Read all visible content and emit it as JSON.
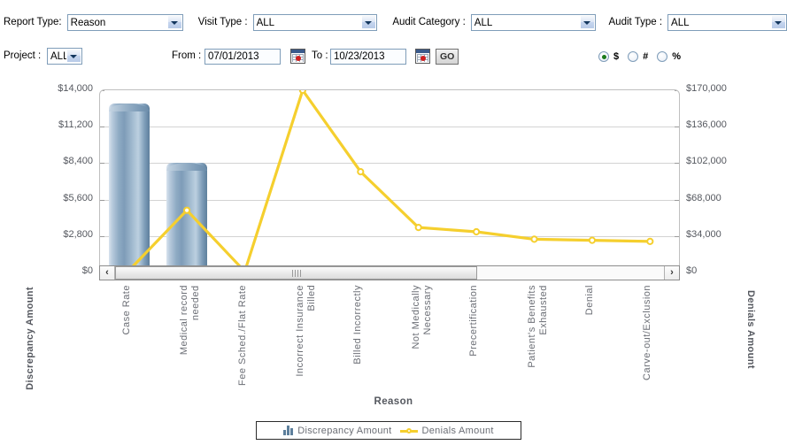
{
  "toolbar": {
    "report_type": {
      "label": "Report Type:",
      "value": "Reason"
    },
    "visit_type": {
      "label": "Visit Type :",
      "value": "ALL"
    },
    "audit_category": {
      "label": "Audit Category :",
      "value": "ALL"
    },
    "audit_type": {
      "label": "Audit Type :",
      "value": "ALL"
    },
    "project": {
      "label": "Project :",
      "value": "ALL"
    },
    "from": {
      "label": "From :",
      "value": "07/01/2013"
    },
    "to": {
      "label": "To :",
      "value": "10/23/2013"
    },
    "go_label": "GO",
    "calendar_icon": "calendar-icon",
    "measures": [
      {
        "label": "$",
        "selected": true
      },
      {
        "label": "#",
        "selected": false
      },
      {
        "label": "%",
        "selected": false
      }
    ]
  },
  "scrollbar": {
    "left_arrow": "‹",
    "right_arrow": "›",
    "thumb_percent": 66
  },
  "legend": {
    "bar_label": "Discrepancy Amount",
    "line_label": "Denials Amount",
    "bar_icon": "bar-chart-icon",
    "line_icon": "line-marker-icon"
  },
  "colors": {
    "bar": "#7e9cb8",
    "line": "#f5cf2e",
    "grid": "#d3d3d3",
    "axis_text": "#55585f",
    "plot_border": "#bfbfbf"
  },
  "chart_data": {
    "type": "bar",
    "title": "",
    "xlabel": "Reason",
    "ylabel": "Discrepancy Amount",
    "y2label": "Denials Amount",
    "grid": true,
    "legend_position": "bottom",
    "categories": [
      "Case Rate",
      "Medical record\nneeded",
      "Fee Sched./Flat Rate",
      "Incorrect Insurance\nBilled",
      "Billed Incorrectly",
      "Not Medically\nNecessary",
      "Precertification",
      "Patient's Benefits\nExhausted",
      "Denial",
      "Carve-out/Exclusion"
    ],
    "ylim": [
      0,
      14000
    ],
    "yticks": [
      0,
      2800,
      5600,
      8400,
      11200,
      14000
    ],
    "ytick_labels": [
      "$0",
      "$2,800",
      "$5,600",
      "$8,400",
      "$11,200",
      "$14,000"
    ],
    "y2lim": [
      0,
      170000
    ],
    "y2ticks": [
      0,
      34000,
      68000,
      102000,
      136000,
      170000
    ],
    "y2tick_labels": [
      "$0",
      "$34,000",
      "$68,000",
      "$102,000",
      "$136,000",
      "$170,000"
    ],
    "series": [
      {
        "name": "Discrepancy Amount",
        "type": "bar",
        "axis": "left",
        "values": [
          12950,
          8400,
          450,
          0,
          0,
          0,
          0,
          0,
          0,
          0
        ]
      },
      {
        "name": "Denials Amount",
        "type": "line",
        "axis": "right",
        "values": [
          2000,
          58000,
          1000,
          170000,
          94000,
          42000,
          38000,
          31000,
          30000,
          29000
        ]
      }
    ]
  }
}
